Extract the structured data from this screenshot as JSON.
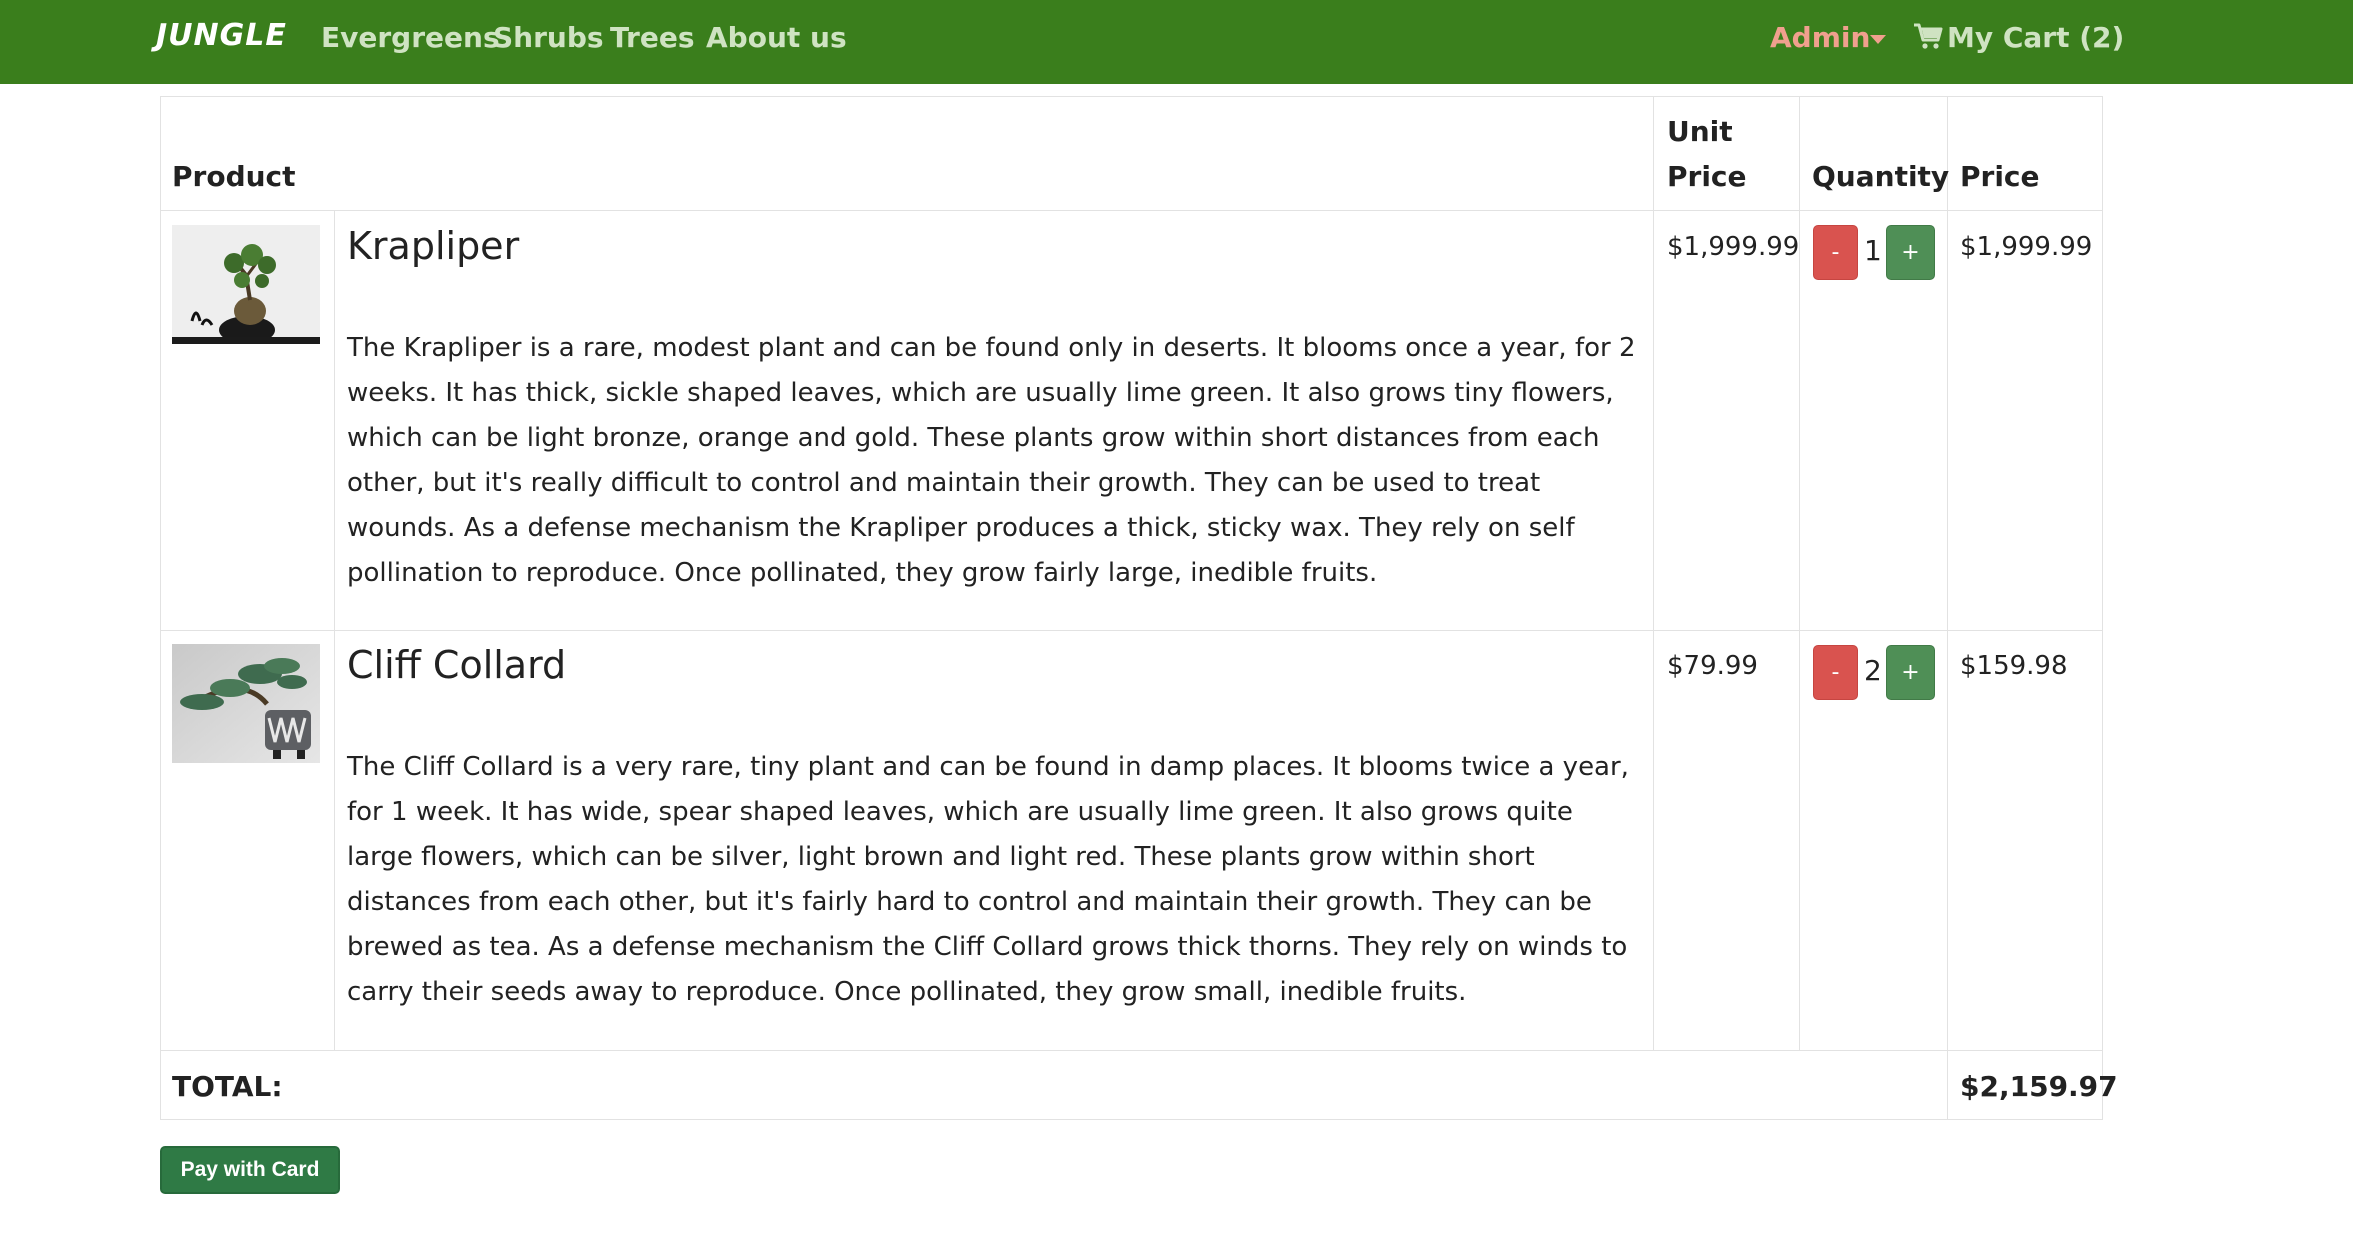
{
  "navbar": {
    "brand": "JUNGLE",
    "links": [
      "Evergreens",
      "Shrubs",
      "Trees",
      "About us"
    ],
    "admin_label": "Admin",
    "cart_label": "My Cart (2)",
    "colors": {
      "bar": "#3a7e1c",
      "admin": "#f0a08e",
      "link": "#cfe3c2"
    }
  },
  "table": {
    "headers": {
      "product": "Product",
      "unit_price_line1": "Unit",
      "unit_price_line2": "Price",
      "quantity": "Quantity",
      "price": "Price"
    },
    "rows": [
      {
        "name": "Krapliper",
        "thumb_icon": "bonsai-tree-thumbnail",
        "description": "The Krapliper is a rare, modest plant and can be found only in deserts. It blooms once a year, for 2 weeks. It has thick, sickle shaped leaves, which are usually lime green. It also grows tiny flowers, which can be light bronze, orange and gold. These plants grow within short distances from each other, but it's really difficult to control and maintain their growth. They can be used to treat wounds. As a defense mechanism the Krapliper produces a thick, sticky wax. They rely on self pollination to reproduce. Once pollinated, they grow fairly large, inedible fruits.",
        "unit_price": "$1,999.99",
        "quantity": "1",
        "price": "$1,999.99"
      },
      {
        "name": "Cliff Collard",
        "thumb_icon": "cascade-bonsai-thumbnail",
        "description": "The Cliff Collard is a very rare, tiny plant and can be found in damp places. It blooms twice a year, for 1 week. It has wide, spear shaped leaves, which are usually lime green. It also grows quite large flowers, which can be silver, light brown and light red. These plants grow within short distances from each other, but it's fairly hard to control and maintain their growth. They can be brewed as tea. As a defense mechanism the Cliff Collard grows thick thorns. They rely on winds to carry their seeds away to reproduce. Once pollinated, they grow small, inedible fruits.",
        "unit_price": "$79.99",
        "quantity": "2",
        "price": "$159.98"
      }
    ],
    "decrement_label": "-",
    "increment_label": "+",
    "total_label": "TOTAL:",
    "total_value": "$2,159.97"
  },
  "pay_button": "Pay with Card"
}
